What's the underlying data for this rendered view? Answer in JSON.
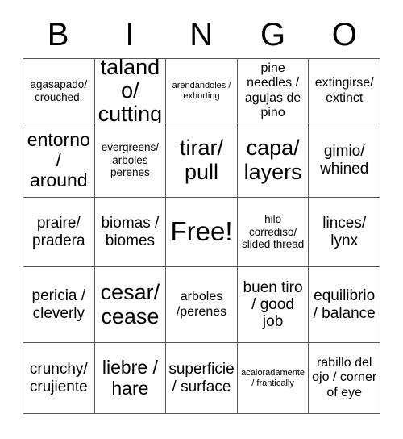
{
  "card": {
    "header_letters": [
      "B",
      "I",
      "N",
      "G",
      "O"
    ],
    "rows": [
      [
        {
          "text": "agasapado/ crouched.",
          "size": "fs-xs"
        },
        {
          "text": "talando/ cutting",
          "size": "fs-xl"
        },
        {
          "text": "arendandoles / exhorting",
          "size": "fs-xxs"
        },
        {
          "text": "pine needles / agujas de pino",
          "size": "fs-s"
        },
        {
          "text": "extingirse/ extinct",
          "size": "fs-s"
        }
      ],
      [
        {
          "text": "entorno / around",
          "size": "fs-l"
        },
        {
          "text": "evergreens/ arboles perenes",
          "size": "fs-xs"
        },
        {
          "text": "tirar/ pull",
          "size": "fs-xl"
        },
        {
          "text": "capa/ layers",
          "size": "fs-xl"
        },
        {
          "text": "gimio/ whined",
          "size": "fs-m"
        }
      ],
      [
        {
          "text": "praire/ pradera",
          "size": "fs-m"
        },
        {
          "text": "biomas / biomes",
          "size": "fs-m"
        },
        {
          "text": "Free!",
          "size": "fs-free"
        },
        {
          "text": "hilo corrediso/ slided thread",
          "size": "fs-xs"
        },
        {
          "text": "linces/ lynx",
          "size": "fs-m"
        }
      ],
      [
        {
          "text": "pericia / cleverly",
          "size": "fs-m"
        },
        {
          "text": "cesar/ cease",
          "size": "fs-xl"
        },
        {
          "text": "arboles /perenes",
          "size": "fs-s"
        },
        {
          "text": "buen tiro / good job",
          "size": "fs-m"
        },
        {
          "text": "equilibrio / balance",
          "size": "fs-m"
        }
      ],
      [
        {
          "text": "crunchy/ crujiente",
          "size": "fs-m"
        },
        {
          "text": "liebre / hare",
          "size": "fs-l"
        },
        {
          "text": "superficie / surface",
          "size": "fs-m"
        },
        {
          "text": "acaloradamente/ frantically",
          "size": "fs-xxs"
        },
        {
          "text": "rabillo del ojo / corner of eye",
          "size": "fs-s"
        }
      ]
    ]
  },
  "colors": {
    "border": "#555555",
    "text": "#000000",
    "background": "#ffffff"
  }
}
